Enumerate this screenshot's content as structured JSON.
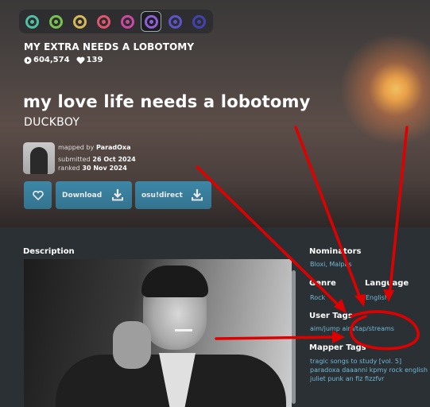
{
  "difficulties": [
    {
      "name": "easy",
      "color": "#4fc0a4"
    },
    {
      "name": "normal",
      "color": "#78c24e"
    },
    {
      "name": "hard",
      "color": "#d6b85a"
    },
    {
      "name": "insane",
      "color": "#e0566e"
    },
    {
      "name": "expert",
      "color": "#c94aa0"
    },
    {
      "name": "expert+",
      "color": "#8f5fd6",
      "active": true
    },
    {
      "name": "expert++",
      "color": "#5a56c9"
    },
    {
      "name": "expert+++",
      "color": "#4343b0"
    }
  ],
  "difficulty_name": "MY EXTRA NEEDS A LOBOTOMY",
  "stats": {
    "plays": "604,574",
    "favourites": "139"
  },
  "song": {
    "title": "my love life needs a lobotomy",
    "artist": "DUCKBOY"
  },
  "mapper": {
    "prefix": "mapped by",
    "name": "ParadOxa",
    "submitted_label": "submitted",
    "submitted_date": "26 Oct 2024",
    "ranked_label": "ranked",
    "ranked_date": "30 Nov 2024"
  },
  "buttons": {
    "download": "Download",
    "direct": "osu!direct"
  },
  "description": {
    "heading": "Description"
  },
  "sidebar": {
    "nominators_label": "Nominators",
    "nominators": "Bloxi, Malpas",
    "genre_label": "Genre",
    "genre": "Rock",
    "language_label": "Language",
    "language": "English",
    "user_tags_label": "User Tags",
    "user_tags": "aim/jump  aim/tap/streams",
    "mapper_tags_label": "Mapper Tags",
    "mapper_tags": "tragic songs to study [vol. 5] paradoxa daaanni kpmy rock english juliet punk an fiz fizzfvr"
  },
  "colors": {
    "accent": "#3d88a8",
    "link": "#73b9d6",
    "annotation": "#e00000"
  }
}
